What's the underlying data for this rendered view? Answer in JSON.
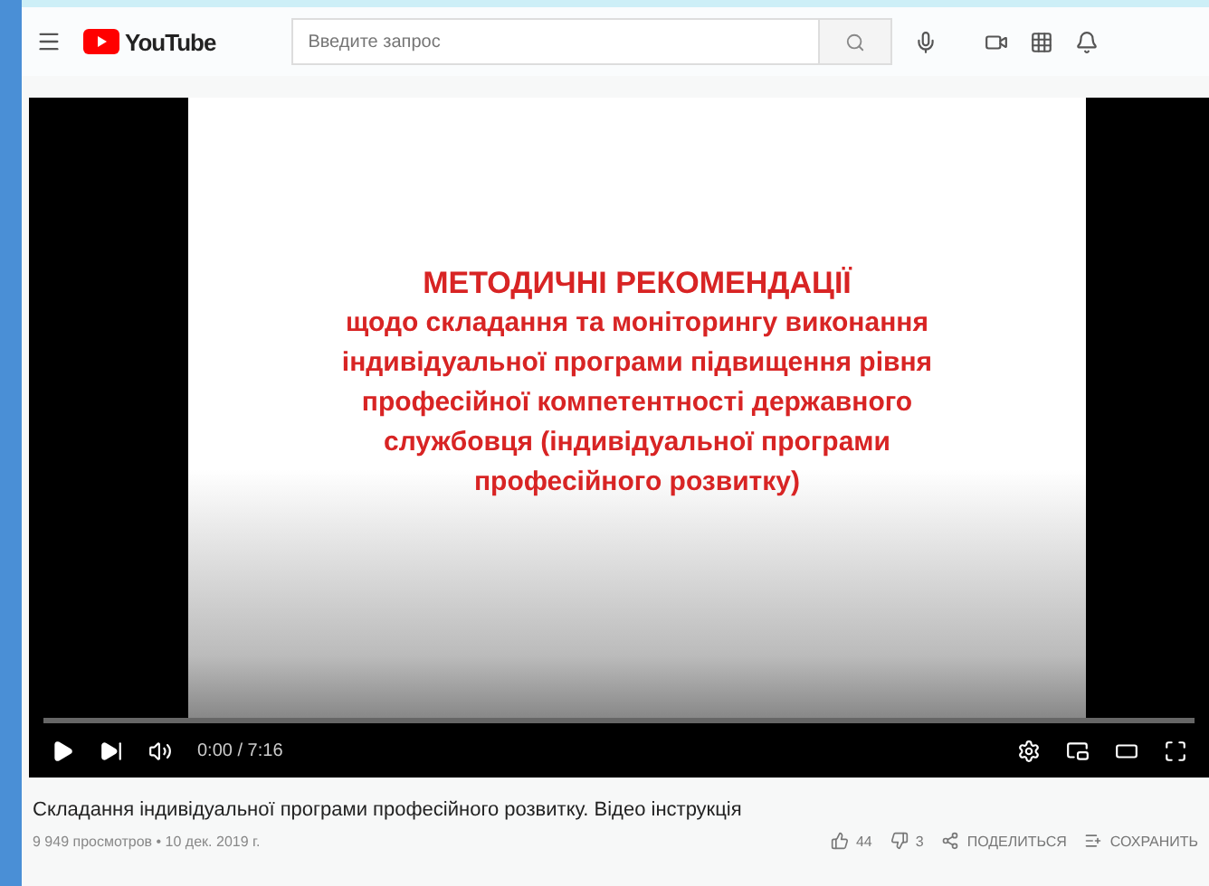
{
  "header": {
    "logo": "YouTube",
    "search": {
      "placeholder": "Введите запрос"
    }
  },
  "video": {
    "slide_lines": [
      "МЕТОДИЧНІ РЕКОМЕНДАЦІЇ",
      "щодо складання та моніторингу виконання",
      "індивідуальної програми підвищення рівня",
      "професійної компетентності державного",
      "службовця (індивідуальної програми",
      "професійного розвитку)"
    ],
    "time": "0:00 / 7:16"
  },
  "title": "Складання індивідуальної програми професійного розвитку. Відео інструкція",
  "meta": "9 949 просмотров • 10 дек. 2019 г.",
  "actions": [
    {
      "kind": "like",
      "label": "44"
    },
    {
      "kind": "dislike",
      "label": "3"
    },
    {
      "kind": "share",
      "label": "ПОДЕЛИТЬСЯ"
    },
    {
      "kind": "save",
      "label": "СОХРАНИТЬ"
    }
  ]
}
